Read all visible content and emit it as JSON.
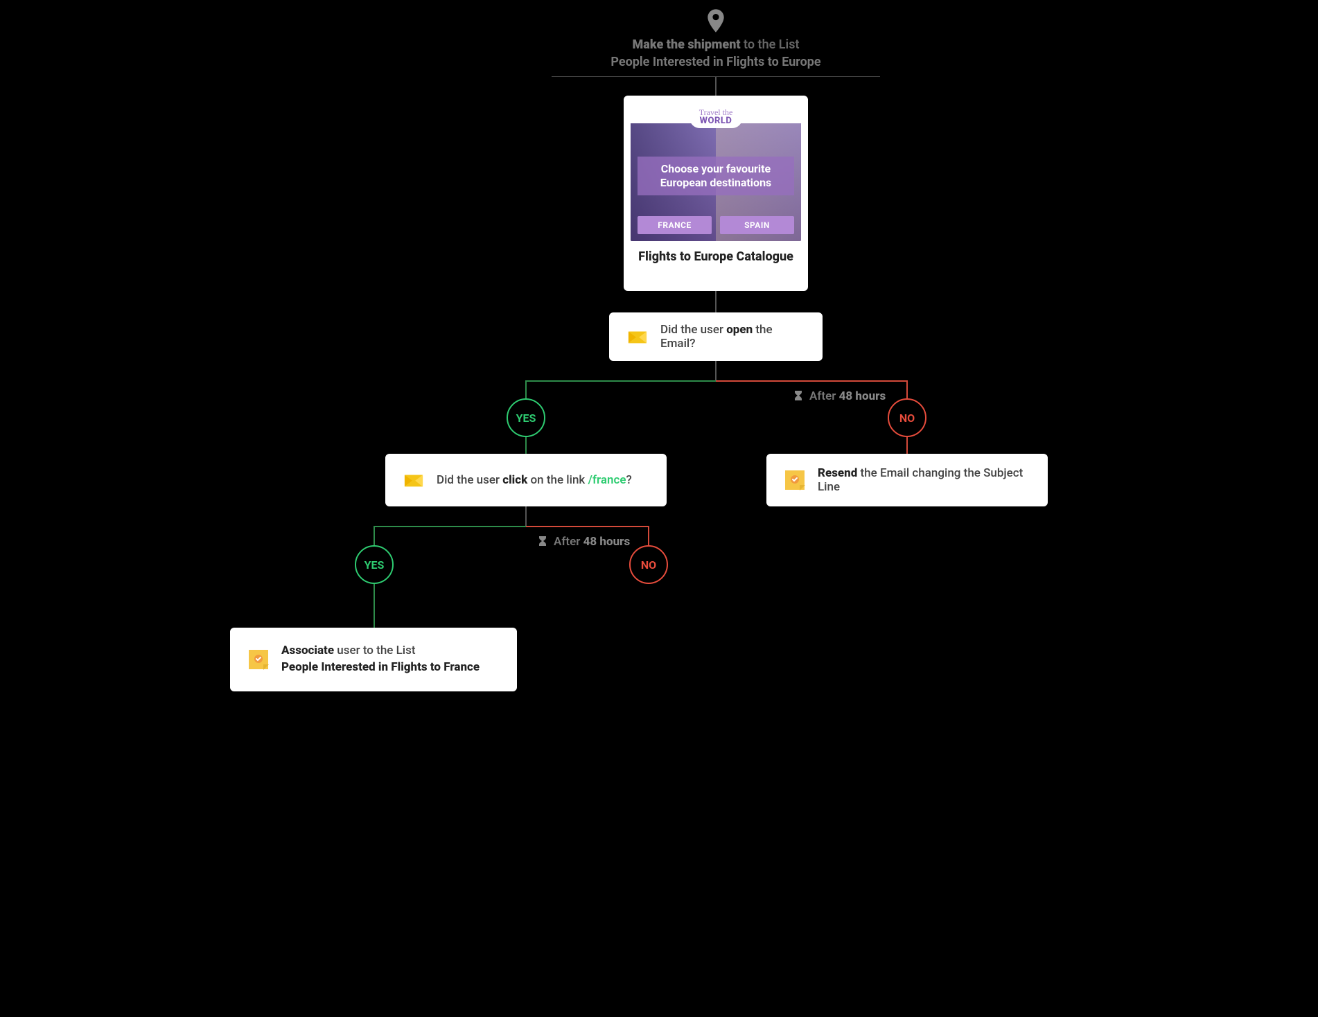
{
  "header": {
    "line1_bold": "Make the shipment",
    "line1_rest": " to the List",
    "line2": "People Interested in Flights to Europe"
  },
  "email_preview": {
    "brand_script": "Travel the",
    "brand_bold": "WORLD",
    "overlay_line1": "Choose your favourite",
    "overlay_line2": "European destinations",
    "btn_left": "FRANCE",
    "btn_right": "SPAIN",
    "title": "Flights to Europe Catalogue"
  },
  "q_open": {
    "prefix": "Did the user ",
    "bold": "open",
    "suffix": " the Email?"
  },
  "yes_label": "YES",
  "no_label": "NO",
  "wait": {
    "prefix": "After ",
    "value": "48 hours"
  },
  "q_click": {
    "prefix": "Did the user ",
    "bold": "click",
    "mid": " on the link ",
    "link": "/france",
    "suffix": "?"
  },
  "action_resend": {
    "bold": "Resend",
    "rest": " the Email changing the Subject Line"
  },
  "action_associate": {
    "bold": "Associate",
    "rest": " user to the List",
    "line2": "People Interested in Flights to France"
  }
}
